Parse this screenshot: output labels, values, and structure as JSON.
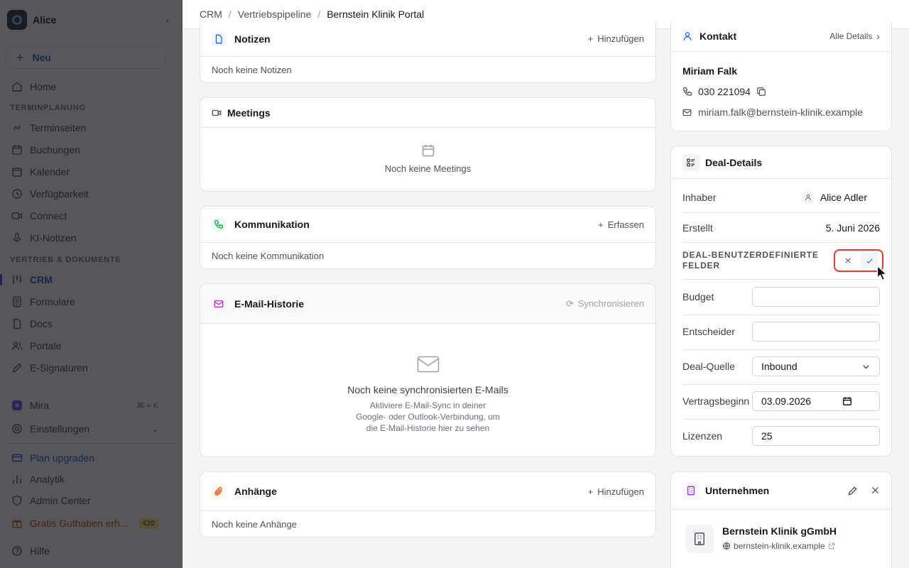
{
  "sidebar": {
    "user": "Alice",
    "new_label": "Neu",
    "home": "Home",
    "section_termin": "TERMINPLANUNG",
    "termin_items": [
      "Terminseiten",
      "Buchungen",
      "Kalender",
      "Verfügbarkeit",
      "Connect",
      "KI-Notizen"
    ],
    "section_vertrieb": "VERTRIEB & DOKUMENTE",
    "vertrieb_items": [
      "CRM",
      "Formulare",
      "Docs",
      "Portale",
      "E-Signaturen"
    ],
    "mira": "Mira",
    "mira_shortcut": "⌘ + K",
    "settings": "Einstellungen",
    "upgrade": "Plan upgraden",
    "analytics": "Analytik",
    "admin": "Admin Center",
    "credit": "Gratis Guthaben erh...",
    "credit_badge": "€20",
    "help": "Hilfe"
  },
  "breadcrumb": {
    "root": "CRM",
    "pipeline": "Vertriebspipeline",
    "current": "Bernstein Klinik Portal"
  },
  "notes": {
    "title": "Notizen",
    "action": "Hinzufügen",
    "empty": "Noch keine Notizen"
  },
  "meetings": {
    "title": "Meetings",
    "empty": "Noch keine Meetings"
  },
  "communication": {
    "title": "Kommunikation",
    "action": "Erfassen",
    "empty": "Noch keine Kommunikation"
  },
  "email_history": {
    "title": "E-Mail-Historie",
    "action": "Synchronisieren",
    "empty_title": "Noch keine synchronisierten E-Mails",
    "empty_line1": "Aktiviere E-Mail-Sync in deiner",
    "empty_line2": "Google- oder Outlook-Verbindung, um",
    "empty_line3": "die E-Mail-Historie hier zu sehen"
  },
  "attachments": {
    "title": "Anhänge",
    "action": "Hinzufügen",
    "empty": "Noch keine Anhänge"
  },
  "contact": {
    "title": "Kontakt",
    "details_link": "Alle Details",
    "name": "Miriam Falk",
    "phone": "030 221094",
    "email": "miriam.falk@bernstein-klinik.example"
  },
  "deal": {
    "title": "Deal-Details",
    "owner_label": "Inhaber",
    "owner": "Alice Adler",
    "created_label": "Erstellt",
    "created": "5. Juni 2026",
    "custom_fields_line1": "DEAL-BENUTZERDEFINIERTE",
    "custom_fields_line2": "FELDER",
    "budget_label": "Budget",
    "budget_value": "",
    "decider_label": "Entscheider",
    "decider_value": "",
    "source_label": "Deal-Quelle",
    "source_value": "Inbound",
    "contract_label": "Vertragsbeginn",
    "contract_value": "03.09.2026",
    "licenses_label": "Lizenzen",
    "licenses_value": "25"
  },
  "company": {
    "title": "Unternehmen",
    "name": "Bernstein Klinik gGmbH",
    "website": "bernstein-klinik.example"
  },
  "colors": {
    "accent": "#1d4ed8",
    "highlight": "#e53935",
    "overlay": "#18181b"
  }
}
